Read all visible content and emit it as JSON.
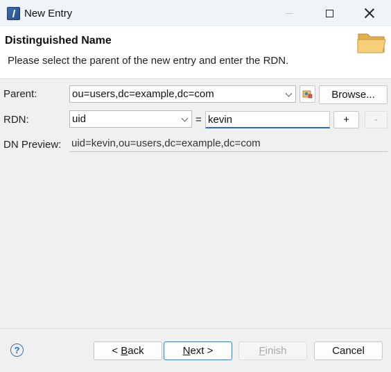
{
  "window": {
    "title": "New Entry"
  },
  "header": {
    "title": "Distinguished Name",
    "description": "Please select the parent of the new entry and enter the RDN."
  },
  "form": {
    "parent_label": "Parent:",
    "parent_value": "ou=users,dc=example,dc=com",
    "browse_label": "Browse...",
    "rdn_label": "RDN:",
    "rdn_attribute": "uid",
    "equals": "=",
    "rdn_value": "kevin",
    "add_label": "+",
    "remove_label": "-",
    "preview_label": "DN Preview:",
    "preview_value": "uid=kevin,ou=users,dc=example,dc=com"
  },
  "footer": {
    "help_label": "?",
    "back_prefix": "< ",
    "back_mnemonic": "B",
    "back_rest": "ack",
    "next_mnemonic": "N",
    "next_rest": "ext >",
    "finish_mnemonic": "F",
    "finish_rest": "inish",
    "cancel_label": "Cancel"
  },
  "icons": {
    "app": "eclipse-app-icon",
    "wizard": "folder-icon",
    "parent_picker": "directory-picker-icon",
    "help": "help-icon"
  },
  "colors": {
    "title_bar": "#eef4f8",
    "accent": "#2d6bb5",
    "default_button_border": "#3c7fcf"
  }
}
